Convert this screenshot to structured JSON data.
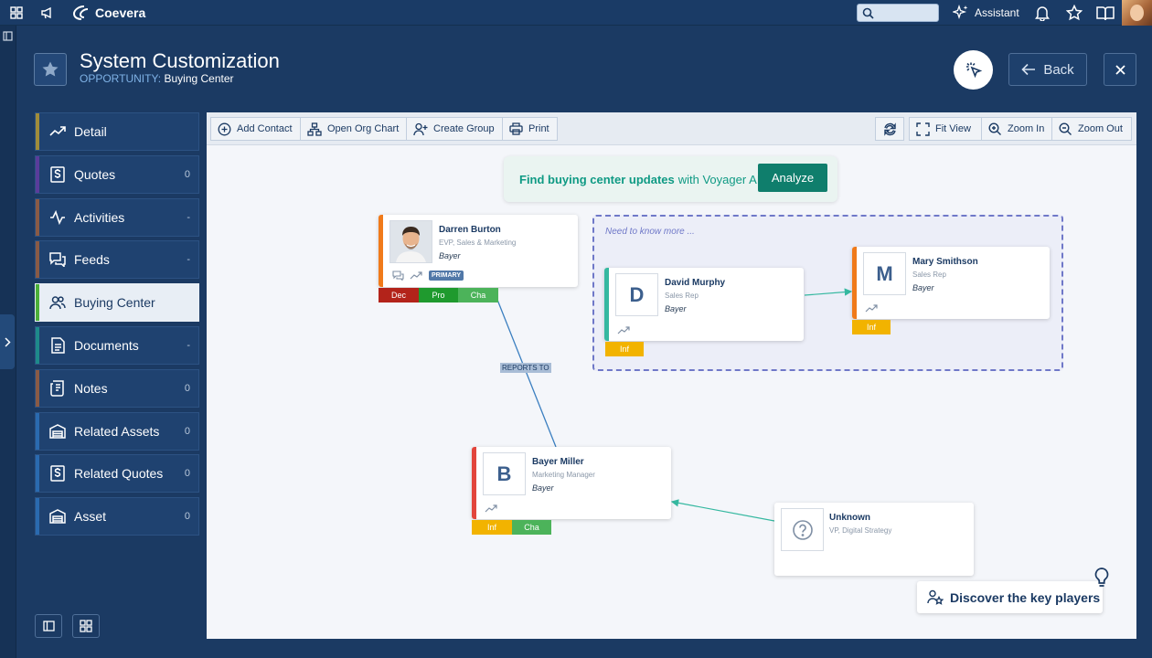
{
  "topbar": {
    "brand": "Coevera",
    "search_placeholder": "",
    "assistant_label": "Assistant"
  },
  "header": {
    "title": "System Customization",
    "subtitle_key": "OPPORTUNITY:",
    "subtitle_value": "Buying Center",
    "back_label": "Back"
  },
  "nav": {
    "items": [
      {
        "label": "Detail",
        "count": "",
        "color": "#a08c3a",
        "icon": "trend-icon"
      },
      {
        "label": "Quotes",
        "count": "0",
        "color": "#5a3c9a",
        "icon": "dollar-doc-icon"
      },
      {
        "label": "Activities",
        "count": "-",
        "color": "#8a5a45",
        "icon": "pulse-icon"
      },
      {
        "label": "Feeds",
        "count": "-",
        "color": "#8a5a45",
        "icon": "chat-icon"
      },
      {
        "label": "Buying Center",
        "count": "",
        "color": "#4caf3a",
        "icon": "people-icon"
      },
      {
        "label": "Documents",
        "count": "-",
        "color": "#1e8a8a",
        "icon": "document-icon"
      },
      {
        "label": "Notes",
        "count": "0",
        "color": "#8a5a45",
        "icon": "notes-icon"
      },
      {
        "label": "Related Assets",
        "count": "0",
        "color": "#2a6ab0",
        "icon": "warehouse-icon"
      },
      {
        "label": "Related Quotes",
        "count": "0",
        "color": "#2a6ab0",
        "icon": "dollar-doc-icon"
      },
      {
        "label": "Asset",
        "count": "0",
        "color": "#2a6ab0",
        "icon": "warehouse-icon"
      }
    ]
  },
  "toolbar": {
    "add_contact": "Add Contact",
    "open_org_chart": "Open Org Chart",
    "create_group": "Create Group",
    "print": "Print",
    "fit_view": "Fit View",
    "zoom_in": "Zoom In",
    "zoom_out": "Zoom Out"
  },
  "ai_banner": {
    "bold": "Find buying center updates",
    "normal": "with Voyager AI",
    "button": "Analyze"
  },
  "group": {
    "label": "Need to know more ..."
  },
  "cards": {
    "darren": {
      "name": "Darren Burton",
      "title": "EVP, Sales & Marketing",
      "company": "Bayer",
      "badge": "PRIMARY",
      "tags": [
        "Dec",
        "Pro",
        "Cha"
      ]
    },
    "david": {
      "initial": "D",
      "name": "David Murphy",
      "title": "Sales Rep",
      "company": "Bayer",
      "tags": [
        "Inf"
      ]
    },
    "mary": {
      "initial": "M",
      "name": "Mary Smithson",
      "title": "Sales Rep",
      "company": "Bayer",
      "tags": [
        "Inf"
      ]
    },
    "bayer": {
      "initial": "B",
      "name": "Bayer Miller",
      "title": "Marketing Manager",
      "company": "Bayer",
      "tags": [
        "Inf",
        "Cha"
      ]
    },
    "unknown": {
      "name": "Unknown",
      "title": "VP, Digital Strategy"
    }
  },
  "relation_label": "REPORTS TO",
  "discover_label": "Discover the key players",
  "colors": {
    "dec": "#b3231a",
    "pro": "#1f9a2e",
    "cha": "#4cb35a",
    "inf": "#f2b300",
    "orange_accent": "#f07a1a",
    "teal_accent": "#35b8a0",
    "red_accent": "#e2453c"
  }
}
